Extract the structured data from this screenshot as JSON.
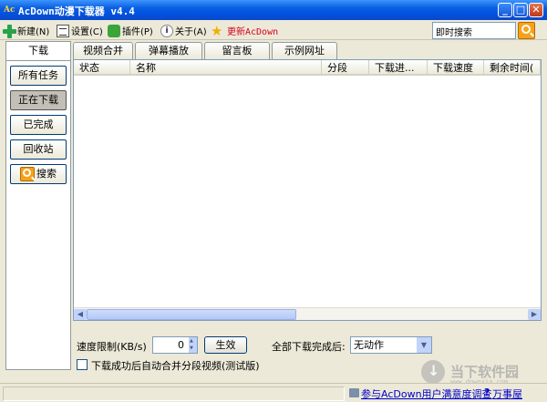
{
  "window": {
    "title": "AcDown动漫下载器 v4.4",
    "logo_text": "Ac"
  },
  "toolbar": {
    "new_label": "新建(N)",
    "settings_label": "设置(C)",
    "plugins_label": "插件(P)",
    "about_label": "关于(A)",
    "update_label": "更新AcDown",
    "instant_search_placeholder": "即时搜索"
  },
  "left": {
    "tab_label": "下载",
    "items": [
      {
        "label": "所有任务"
      },
      {
        "label": "正在下载"
      },
      {
        "label": "已完成"
      },
      {
        "label": "回收站"
      },
      {
        "label": "搜索"
      }
    ]
  },
  "tabs": [
    {
      "label": "视频合并"
    },
    {
      "label": "弹幕播放"
    },
    {
      "label": "留言板"
    },
    {
      "label": "示例网址"
    }
  ],
  "table": {
    "columns": [
      "状态",
      "名称",
      "分段",
      "下载进...",
      "下载速度",
      "剩余时间("
    ]
  },
  "bottom": {
    "speed_label": "速度限制(KB/s)",
    "speed_value": "0",
    "apply_label": "生效",
    "after_all_label": "全部下载完成后:",
    "after_all_value": "无动作",
    "merge_label": "下载成功后自动合并分段视频(测试版)"
  },
  "status": {
    "survey_link": "参与AcDown用户满意度调查",
    "help_link": "万事屋"
  },
  "watermark": {
    "text": "当下软件园",
    "sub": "www.downxia.com"
  },
  "colors": {
    "titlebar": "#0054e3",
    "accent_orange": "#f5a21a",
    "link": "#0000cc",
    "update_red": "#d8001c"
  }
}
